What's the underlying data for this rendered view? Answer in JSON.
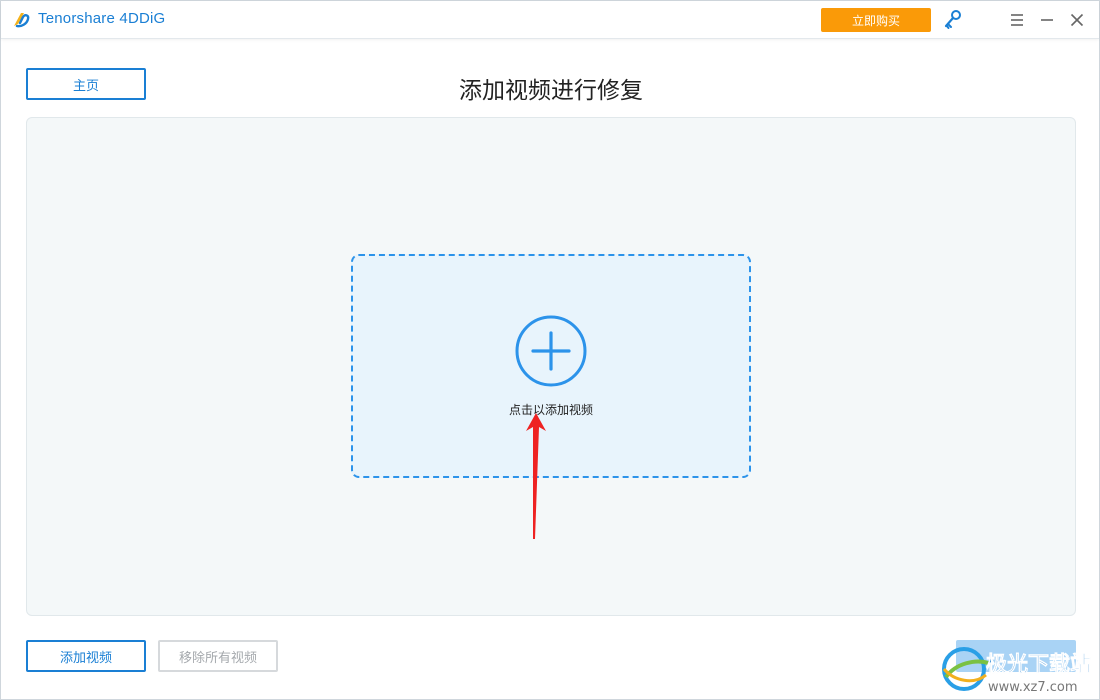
{
  "window": {
    "app_title": "Tenorshare 4DDiG"
  },
  "titlebar": {
    "buy_label": "立即购买",
    "logo_icon": "4ddig-logo-icon",
    "key_icon": "key-icon",
    "menu_icon": "hamburger-menu-icon",
    "minimize_icon": "minimize-icon",
    "close_icon": "close-icon"
  },
  "header": {
    "home_label": "主页",
    "page_title": "添加视频进行修复"
  },
  "dropzone": {
    "icon": "plus-circle-icon",
    "hint": "点击以添加视频"
  },
  "toolbar": {
    "add_video_label": "添加视频",
    "remove_all_label": "移除所有视频"
  },
  "watermark": {
    "brand_text": "极光下载站",
    "url_text": "www.xz7.com"
  },
  "colors": {
    "accent": "#1a7fd4",
    "buy_button": "#fa9a08",
    "dropzone_border": "#2c93ea",
    "dropzone_fill": "#e8f4fc",
    "panel_fill": "#f4f8f9",
    "annotation_arrow": "#ee2222",
    "disabled_button": "#a9d3f5"
  }
}
